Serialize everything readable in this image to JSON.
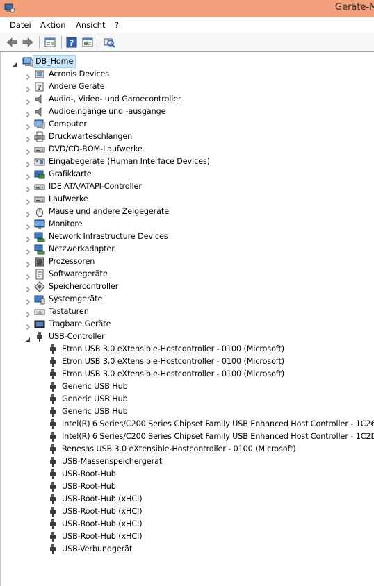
{
  "window": {
    "title": "Geräte-M"
  },
  "menu": [
    "Datei",
    "Aktion",
    "Ansicht",
    "?"
  ],
  "toolbar": {
    "buttons": [
      {
        "name": "back-icon"
      },
      {
        "name": "forward-icon"
      },
      {
        "name": "properties-icon"
      },
      {
        "name": "help-icon"
      },
      {
        "name": "device-view-icon"
      },
      {
        "name": "scan-hardware-icon"
      }
    ]
  },
  "tree": {
    "root": "DB_Home",
    "categories": [
      {
        "label": "Acronis Devices",
        "icon": "generic-device-icon"
      },
      {
        "label": "Andere Geräte",
        "icon": "unknown-device-icon"
      },
      {
        "label": "Audio-, Video- und Gamecontroller",
        "icon": "speaker-icon"
      },
      {
        "label": "Audioeingänge und -ausgänge",
        "icon": "speaker-icon"
      },
      {
        "label": "Computer",
        "icon": "computer-icon"
      },
      {
        "label": "Druckwarteschlangen",
        "icon": "printer-icon"
      },
      {
        "label": "DVD/CD-ROM-Laufwerke",
        "icon": "dvd-drive-icon"
      },
      {
        "label": "Eingabegeräte (Human Interface Devices)",
        "icon": "hid-icon"
      },
      {
        "label": "Grafikkarte",
        "icon": "display-adapter-icon"
      },
      {
        "label": "IDE ATA/ATAPI-Controller",
        "icon": "ide-controller-icon"
      },
      {
        "label": "Laufwerke",
        "icon": "disk-drive-icon"
      },
      {
        "label": "Mäuse und andere Zeigegeräte",
        "icon": "mouse-icon"
      },
      {
        "label": "Monitore",
        "icon": "monitor-icon"
      },
      {
        "label": "Network Infrastructure Devices",
        "icon": "network-device-icon"
      },
      {
        "label": "Netzwerkadapter",
        "icon": "network-adapter-icon"
      },
      {
        "label": "Prozessoren",
        "icon": "processor-icon"
      },
      {
        "label": "Softwaregeräte",
        "icon": "software-device-icon"
      },
      {
        "label": "Speichercontroller",
        "icon": "storage-controller-icon"
      },
      {
        "label": "Systemgeräte",
        "icon": "system-device-icon"
      },
      {
        "label": "Tastaturen",
        "icon": "keyboard-icon"
      },
      {
        "label": "Tragbare Geräte",
        "icon": "portable-device-icon"
      },
      {
        "label": "USB-Controller",
        "icon": "usb-icon",
        "expanded": true
      }
    ],
    "usb_children": [
      "Etron USB 3.0 eXtensible-Hostcontroller - 0100 (Microsoft)",
      "Etron USB 3.0 eXtensible-Hostcontroller - 0100 (Microsoft)",
      "Etron USB 3.0 eXtensible-Hostcontroller - 0100 (Microsoft)",
      "Generic USB Hub",
      "Generic USB Hub",
      "Generic USB Hub",
      "Intel(R) 6 Series/C200 Series Chipset Family USB Enhanced Host Controller - 1C26",
      "Intel(R) 6 Series/C200 Series Chipset Family USB Enhanced Host Controller - 1C2D",
      "Renesas USB 3.0 eXtensible-Hostcontroller - 0100 (Microsoft)",
      "USB-Massenspeichergerät",
      "USB-Root-Hub",
      "USB-Root-Hub",
      "USB-Root-Hub (xHCI)",
      "USB-Root-Hub (xHCI)",
      "USB-Root-Hub (xHCI)",
      "USB-Root-Hub (xHCI)",
      "USB-Verbundgerät"
    ]
  },
  "colors": {
    "titlebar": "#f2a07a",
    "selection": "#cce8ff"
  }
}
